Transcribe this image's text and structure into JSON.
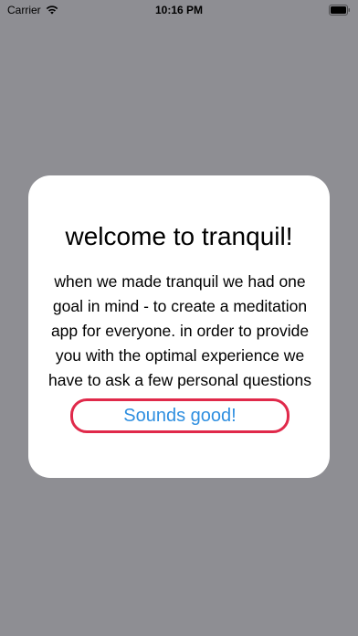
{
  "status_bar": {
    "carrier": "Carrier",
    "time": "10:16 PM",
    "wifi_icon": "wifi-icon",
    "battery_icon": "battery-icon"
  },
  "modal": {
    "title": "welcome to tranquil!",
    "body": "when we made tranquil we had one goal in mind - to create a meditation app for everyone. in order to provide you with the optimal experience we have to ask a few personal questions",
    "button_label": "Sounds good!"
  },
  "colors": {
    "backdrop": "#8e8e93",
    "modal_background": "#ffffff",
    "button_border": "#e0294a",
    "button_text": "#2f8fe0"
  }
}
